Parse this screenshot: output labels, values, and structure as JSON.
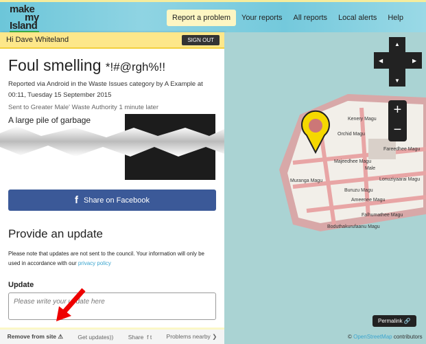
{
  "header": {
    "logo": [
      "make",
      "my",
      "Island"
    ],
    "nav": [
      "Report a problem",
      "Your reports",
      "All reports",
      "Local alerts",
      "Help"
    ]
  },
  "user": {
    "greeting": "Hi Dave Whiteland",
    "sign_out": "SIGN OUT"
  },
  "report": {
    "title_main": "Foul smelling ",
    "title_symbols": "*!#@rgh%!!",
    "meta": "Reported via Android in the Waste Issues category by A Example at 00:11, Tuesday 15 September 2015",
    "sent": "Sent to Greater Male' Waste Authority 1 minute later",
    "description": "A large pile of garbage"
  },
  "share_facebook": "Share on Facebook",
  "update": {
    "heading": "Provide an update",
    "note": "Please note that updates are not sent to the council. Your information will only be used in accordance with our ",
    "privacy_link": "privacy policy",
    "label": "Update",
    "placeholder": "Please write your update here"
  },
  "footer": {
    "remove": "Remove from site",
    "get_updates": "Get updates",
    "share": "Share",
    "nearby": "Problems nearby"
  },
  "map": {
    "labels": [
      "Orchid Magu",
      "Majeedhee Magu",
      "Male",
      "Buruzu Magu",
      "Ameenee Magu",
      "Boduthakurufaanu Magu",
      "Lonuziyaarai Magu",
      "Fareedhee Magu",
      "Muranga Magu",
      "Falhumathee Magu",
      "Kenery Magu"
    ],
    "permalink": "Permalink",
    "attribution_prefix": "© ",
    "attribution_link": "OpenStreetMap",
    "attribution_suffix": " contributors"
  },
  "colors": {
    "accent": "#3bb54a",
    "sign_bar": "#fde78a",
    "facebook": "#3b5998",
    "link": "#3ba5cf",
    "pin": "#f5d800"
  }
}
